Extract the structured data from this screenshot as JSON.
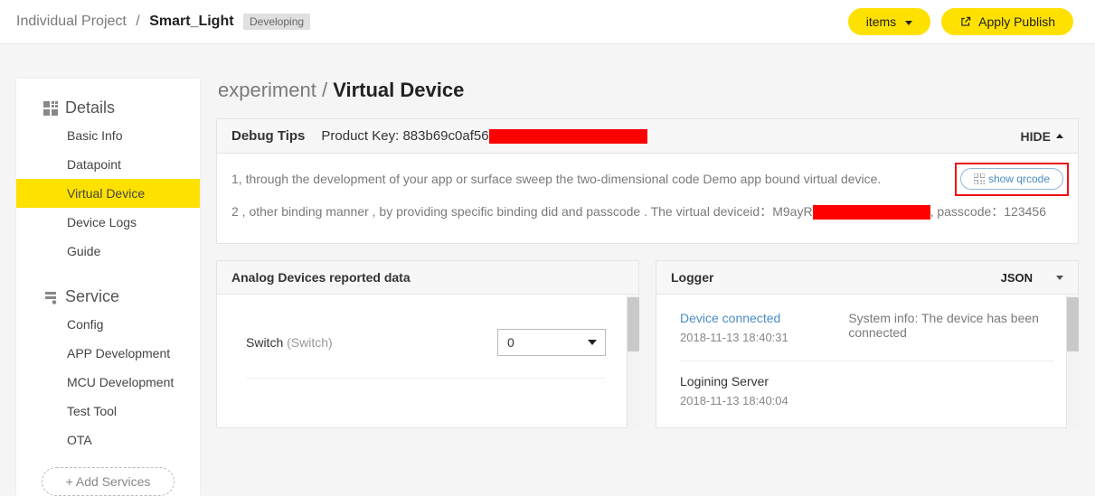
{
  "header": {
    "breadcrumb_root": "Individual Project",
    "breadcrumb_sep": "/",
    "breadcrumb_current": "Smart_Light",
    "status": "Developing",
    "items_label": "items",
    "apply_publish_label": "Apply Publish"
  },
  "sidebar": {
    "details_header": "Details",
    "details_items": [
      "Basic Info",
      "Datapoint",
      "Virtual Device",
      "Device Logs",
      "Guide"
    ],
    "details_active_index": 2,
    "service_header": "Service",
    "service_items": [
      "Config",
      "APP Development",
      "MCU Development",
      "Test Tool",
      "OTA"
    ],
    "add_services_label": "+ Add Services"
  },
  "main": {
    "title_root": "experiment",
    "title_sep": "/",
    "title_current": "Virtual Device",
    "debug": {
      "title": "Debug Tips",
      "product_key_label": "Product Key:",
      "product_key_prefix": "883b69c0af56",
      "hide_label": "HIDE",
      "qr_label": "show qrcode",
      "tip1": "1, through the development of your app or surface sweep the two-dimensional code Demo app bound virtual device.",
      "tip2_a": "2 , other binding manner , by providing specific binding did and passcode . The virtual deviceid：M9ayR",
      "tip2_b": ", passcode：123456"
    },
    "analog": {
      "title": "Analog Devices reported data",
      "dp_name": "Switch",
      "dp_id": "(Switch)",
      "dp_value": "0"
    },
    "logger": {
      "title": "Logger",
      "format": "JSON",
      "entries": [
        {
          "title": "Device connected",
          "ts": "2018-11-13 18:40:31",
          "right": "System info: The device has been connected",
          "link": true
        },
        {
          "title": "Logining Server",
          "ts": "2018-11-13 18:40:04",
          "right": "",
          "link": false
        }
      ]
    }
  }
}
